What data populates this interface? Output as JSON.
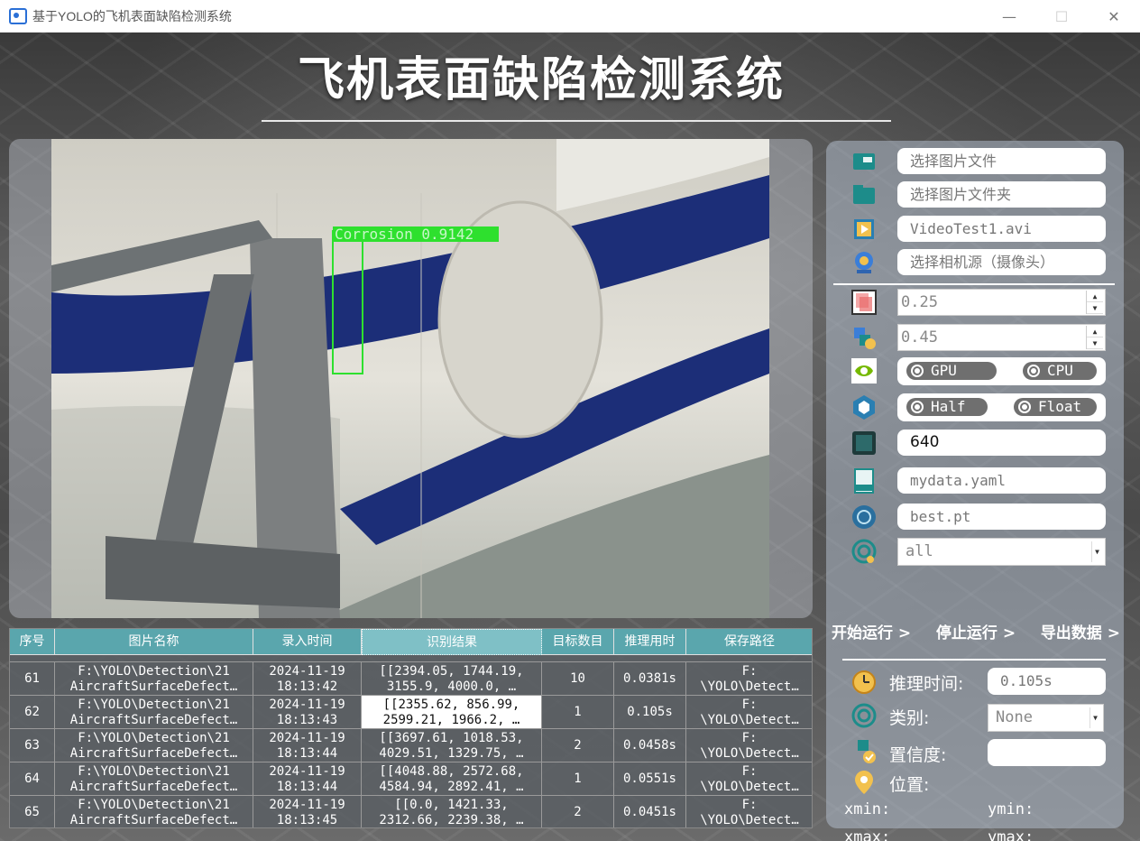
{
  "window": {
    "title": "基于YOLO的飞机表面缺陷检测系统",
    "minimize": "—",
    "maximize": "☐",
    "close": "✕"
  },
  "header": {
    "title": "飞机表面缺陷检测系统"
  },
  "detection": {
    "label": "Corrosion 0.9142"
  },
  "inputs": {
    "image_file": "选择图片文件",
    "image_folder": "选择图片文件夹",
    "video": "VideoTest1.avi",
    "camera": "选择相机源（摄像头）",
    "conf": "0.25",
    "iou": "0.45",
    "device_gpu": "GPU",
    "device_cpu": "CPU",
    "precision_half": "Half",
    "precision_float": "Float",
    "imgsz": "640",
    "yaml": "mydata.yaml",
    "weights": "best.pt",
    "classes": "all"
  },
  "actions": {
    "start": "开始运行 >",
    "stop": "停止运行 >",
    "export": "导出数据 >"
  },
  "stats": {
    "time_label": "推理时间:",
    "time_value": "0.105s",
    "class_label": "类别:",
    "class_value": "None",
    "conf_label": "置信度:",
    "conf_value": "",
    "pos_label": "位置:",
    "xmin": "xmin:",
    "ymin": "ymin:",
    "xmax": "xmax:",
    "ymax": "ymax:"
  },
  "table": {
    "headers": [
      "序号",
      "图片名称",
      "录入时间",
      "识别结果",
      "目标数目",
      "推理用时",
      "保存路径"
    ],
    "rows": [
      {
        "id": "61",
        "name1": "F:\\YOLO\\Detection\\21",
        "name2": "AircraftSurfaceDefect…",
        "date": "2024-11-19",
        "time": "18:13:42",
        "res1": "[[2394.05, 1744.19,",
        "res2": "3155.9, 4000.0, …",
        "count": "10",
        "dur": "0.0381s",
        "path1": "F:",
        "path2": "\\YOLO\\Detect…"
      },
      {
        "id": "62",
        "name1": "F:\\YOLO\\Detection\\21",
        "name2": "AircraftSurfaceDefect…",
        "date": "2024-11-19",
        "time": "18:13:43",
        "res1": "[[2355.62, 856.99,",
        "res2": "2599.21, 1966.2, …",
        "count": "1",
        "dur": "0.105s",
        "path1": "F:",
        "path2": "\\YOLO\\Detect…"
      },
      {
        "id": "63",
        "name1": "F:\\YOLO\\Detection\\21",
        "name2": "AircraftSurfaceDefect…",
        "date": "2024-11-19",
        "time": "18:13:44",
        "res1": "[[3697.61, 1018.53,",
        "res2": "4029.51, 1329.75, …",
        "count": "2",
        "dur": "0.0458s",
        "path1": "F:",
        "path2": "\\YOLO\\Detect…"
      },
      {
        "id": "64",
        "name1": "F:\\YOLO\\Detection\\21",
        "name2": "AircraftSurfaceDefect…",
        "date": "2024-11-19",
        "time": "18:13:44",
        "res1": "[[4048.88, 2572.68,",
        "res2": "4584.94, 2892.41, …",
        "count": "1",
        "dur": "0.0551s",
        "path1": "F:",
        "path2": "\\YOLO\\Detect…"
      },
      {
        "id": "65",
        "name1": "F:\\YOLO\\Detection\\21",
        "name2": "AircraftSurfaceDefect…",
        "date": "2024-11-19",
        "time": "18:13:45",
        "res1": "[[0.0, 1421.33,",
        "res2": "2312.66, 2239.38, …",
        "count": "2",
        "dur": "0.0451s",
        "path1": "F:",
        "path2": "\\YOLO\\Detect…"
      }
    ]
  }
}
